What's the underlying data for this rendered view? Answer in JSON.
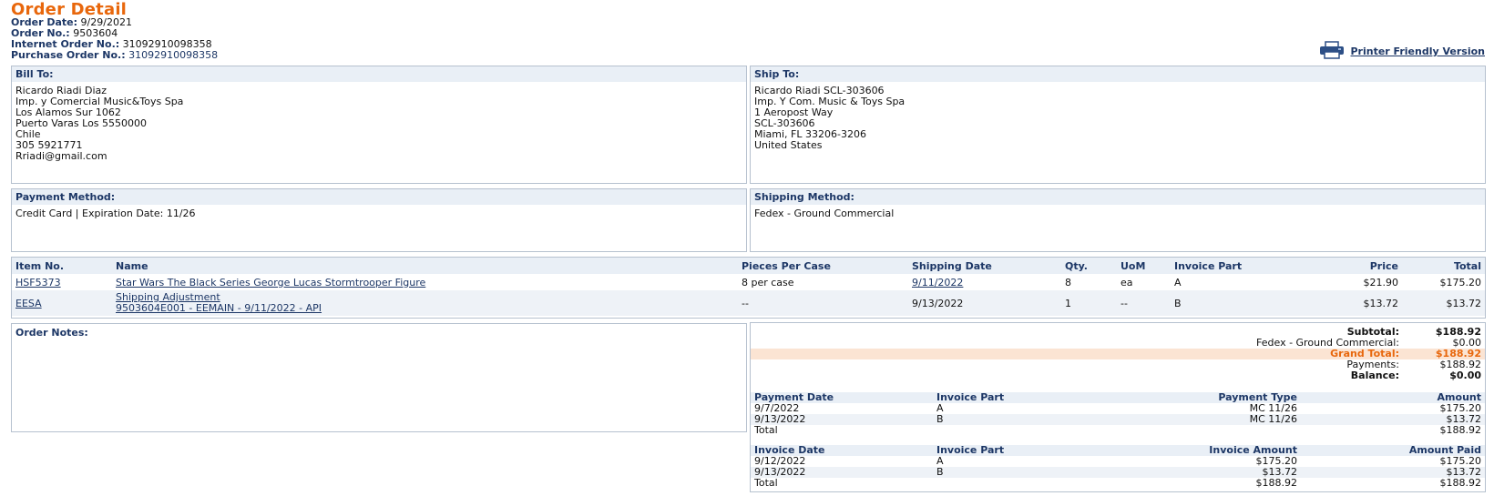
{
  "page": {
    "title": "Order Detail",
    "order_date_label": "Order Date:",
    "order_date": "9/29/2021",
    "order_no_label": "Order No.:",
    "order_no": "9503604",
    "internet_order_label": "Internet Order No.:",
    "internet_order": "31092910098358",
    "po_label": "Purchase Order No.:",
    "po": "31092910098358",
    "printer_link": "Printer Friendly Version"
  },
  "bill_to": {
    "header": "Bill To:",
    "lines": "Ricardo Riadi Diaz\nImp. y Comercial Music&Toys Spa\nLos Alamos Sur 1062\nPuerto Varas Los 5550000\nChile\n305 5921771\nRriadi@gmail.com"
  },
  "ship_to": {
    "header": "Ship To:",
    "lines": "Ricardo Riadi SCL-303606\nImp. Y Com. Music & Toys Spa\n1 Aeropost Way\nSCL-303606\nMiami, FL 33206-3206\nUnited States"
  },
  "payment_method": {
    "header": "Payment Method:",
    "value": "Credit Card | Expiration Date: 11/26"
  },
  "shipping_method": {
    "header": "Shipping Method:",
    "value": "Fedex - Ground Commercial"
  },
  "items": {
    "headers": [
      "Item No.",
      "Name",
      "Pieces Per Case",
      "Shipping Date",
      "Qty.",
      "UoM",
      "Invoice Part",
      "Price",
      "Total"
    ],
    "rows": [
      {
        "item": "HSF5373",
        "name": "Star Wars The Black Series George Lucas Stormtrooper Figure",
        "name2": "",
        "ppc": "8 per case",
        "ship_date": "9/11/2022",
        "qty": "8",
        "uom": "ea",
        "part": "A",
        "price": "$21.90",
        "total": "$175.20"
      },
      {
        "item": "EESA",
        "name": "Shipping Adjustment",
        "name2": "9503604E001 - EEMAIN - 9/11/2022 - API",
        "ppc": "--",
        "ship_date": "9/13/2022",
        "qty": "1",
        "uom": "--",
        "part": "B",
        "price": "$13.72",
        "total": "$13.72"
      }
    ]
  },
  "notes": {
    "header": "Order Notes:"
  },
  "totals": {
    "subtotal_label": "Subtotal:",
    "subtotal": "$188.92",
    "shipping_label": "Fedex - Ground Commercial:",
    "shipping": "$0.00",
    "grand_label": "Grand Total:",
    "grand": "$188.92",
    "payments_label": "Payments:",
    "payments": "$188.92",
    "balance_label": "Balance:",
    "balance": "$0.00"
  },
  "payments_table": {
    "headers": [
      "Payment Date",
      "Invoice Part",
      "Payment Type",
      "Amount"
    ],
    "rows": [
      {
        "date": "9/7/2022",
        "part": "A",
        "type": "MC 11/26",
        "amount": "$175.20"
      },
      {
        "date": "9/13/2022",
        "part": "B",
        "type": "MC 11/26",
        "amount": "$13.72"
      }
    ],
    "total_label": "Total",
    "total": "$188.92"
  },
  "invoices_table": {
    "headers": [
      "Invoice Date",
      "Invoice Part",
      "Invoice Amount",
      "Amount Paid"
    ],
    "rows": [
      {
        "date": "9/12/2022",
        "part": "A",
        "inv_amount": "$175.20",
        "paid": "$175.20"
      },
      {
        "date": "9/13/2022",
        "part": "B",
        "inv_amount": "$13.72",
        "paid": "$13.72"
      }
    ],
    "total_label": "Total",
    "total_inv": "$188.92",
    "total_paid": "$188.92"
  },
  "colors": {
    "accent": "#e8670c",
    "navy": "#1d3766",
    "header_bg": "#e9eff6"
  }
}
